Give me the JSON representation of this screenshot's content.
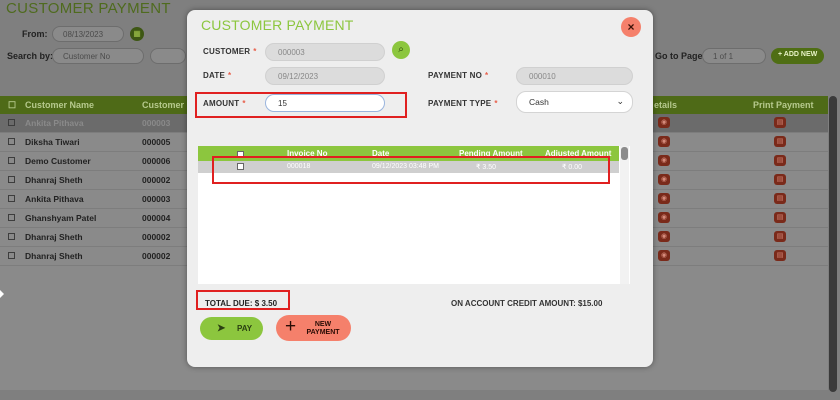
{
  "background": {
    "title": "CUSTOMER PAYMENT",
    "from_label": "From:",
    "from_value": "08/13/2023",
    "search_by_label": "Search by:",
    "search_by_value": "Customer No",
    "go_to_page_label": "Go to Page",
    "page_value": "1 of 1",
    "add_new_label": "+ ADD NEW",
    "columns": [
      "Customer Name",
      "Customer N",
      "etails",
      "Print Payment"
    ],
    "rows": [
      {
        "name": "Ankita Pithava",
        "no": "000003"
      },
      {
        "name": "Diksha Tiwari",
        "no": "000005"
      },
      {
        "name": "Demo Customer",
        "no": "000006"
      },
      {
        "name": "Dhanraj Sheth",
        "no": "000002"
      },
      {
        "name": "Ankita Pithava",
        "no": "000003"
      },
      {
        "name": "Ghanshyam Patel",
        "no": "000004"
      },
      {
        "name": "Dhanraj Sheth",
        "no": "000002"
      },
      {
        "name": "Dhanraj Sheth",
        "no": "000002"
      }
    ]
  },
  "modal": {
    "title": "CUSTOMER PAYMENT",
    "close_icon": "×",
    "customer": {
      "label": "CUSTOMER",
      "required": "*",
      "value": "000003"
    },
    "date": {
      "label": "DATE",
      "required": "*",
      "value": "09/12/2023"
    },
    "amount": {
      "label": "AMOUNT",
      "required": "*",
      "value": "15"
    },
    "payment_no": {
      "label": "PAYMENT NO",
      "required": "*",
      "value": "000010"
    },
    "payment_type": {
      "label": "PAYMENT TYPE",
      "required": "*",
      "value": "Cash"
    },
    "grid": {
      "columns": [
        "Invoice No",
        "Date",
        "Pending Amount",
        "Adjusted Amount"
      ],
      "rows": [
        {
          "invoice_no": "000018",
          "date": "09/12/2023 03:48 PM",
          "pending": "₹ 3.50",
          "adjusted": "₹ 0.00"
        }
      ]
    },
    "total_due": "TOTAL DUE:  $ 3.50",
    "credit": "ON ACCOUNT CREDIT AMOUNT:  $15.00",
    "pay_label": "PAY",
    "new_payment_label": "NEW PAYMENT"
  },
  "colors": {
    "accent_green": "#8cc63e",
    "accent_salmon": "#f5806b",
    "highlight_red": "#e02020"
  }
}
